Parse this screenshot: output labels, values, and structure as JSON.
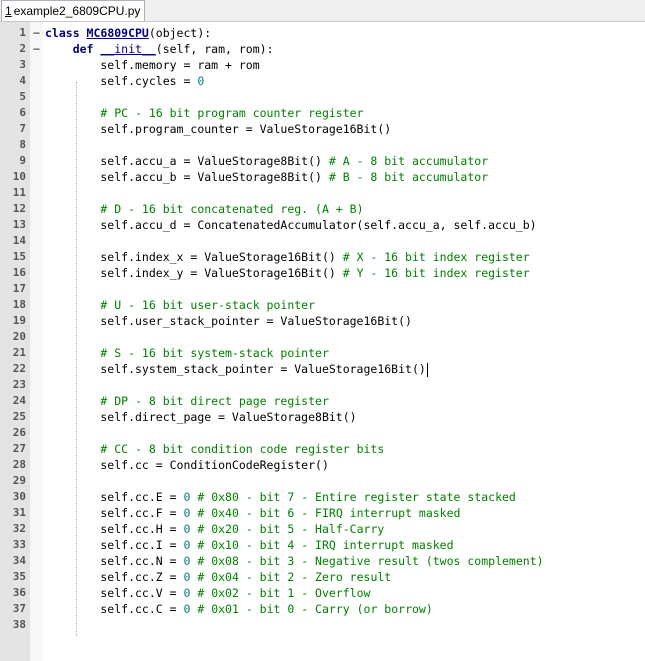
{
  "tab": {
    "number": "1",
    "filename": "example2_6809CPU.py"
  },
  "lines": [
    {
      "n": "1",
      "fold": "−",
      "segs": [
        [
          "kw",
          "class "
        ],
        [
          "cls",
          "MC6809CPU"
        ],
        [
          "p",
          "(object):"
        ]
      ]
    },
    {
      "n": "2",
      "fold": "−",
      "segs": [
        [
          "p",
          "    "
        ],
        [
          "kw",
          "def "
        ],
        [
          "fn",
          "__init__"
        ],
        [
          "p",
          "(self, ram, rom):"
        ]
      ]
    },
    {
      "n": "3",
      "fold": "",
      "segs": [
        [
          "p",
          "        self.memory = ram + rom"
        ]
      ]
    },
    {
      "n": "4",
      "fold": "",
      "segs": [
        [
          "p",
          "        self.cycles = "
        ],
        [
          "nm",
          "0"
        ]
      ]
    },
    {
      "n": "5",
      "fold": "",
      "segs": []
    },
    {
      "n": "6",
      "fold": "",
      "segs": [
        [
          "p",
          "        "
        ],
        [
          "cm",
          "# PC - 16 bit program counter register"
        ]
      ]
    },
    {
      "n": "7",
      "fold": "",
      "segs": [
        [
          "p",
          "        self.program_counter = ValueStorage16Bit()"
        ]
      ]
    },
    {
      "n": "8",
      "fold": "",
      "segs": []
    },
    {
      "n": "9",
      "fold": "",
      "segs": [
        [
          "p",
          "        self.accu_a = ValueStorage8Bit() "
        ],
        [
          "cm",
          "# A - 8 bit accumulator"
        ]
      ]
    },
    {
      "n": "10",
      "fold": "",
      "segs": [
        [
          "p",
          "        self.accu_b = ValueStorage8Bit() "
        ],
        [
          "cm",
          "# B - 8 bit accumulator"
        ]
      ]
    },
    {
      "n": "11",
      "fold": "",
      "segs": []
    },
    {
      "n": "12",
      "fold": "",
      "segs": [
        [
          "p",
          "        "
        ],
        [
          "cm",
          "# D - 16 bit concatenated reg. (A + B)"
        ]
      ]
    },
    {
      "n": "13",
      "fold": "",
      "segs": [
        [
          "p",
          "        self.accu_d = ConcatenatedAccumulator(self.accu_a, self.accu_b)"
        ]
      ]
    },
    {
      "n": "14",
      "fold": "",
      "segs": []
    },
    {
      "n": "15",
      "fold": "",
      "segs": [
        [
          "p",
          "        self.index_x = ValueStorage16Bit() "
        ],
        [
          "cm",
          "# X - 16 bit index register"
        ]
      ]
    },
    {
      "n": "16",
      "fold": "",
      "segs": [
        [
          "p",
          "        self.index_y = ValueStorage16Bit() "
        ],
        [
          "cm",
          "# Y - 16 bit index register"
        ]
      ]
    },
    {
      "n": "17",
      "fold": "",
      "segs": []
    },
    {
      "n": "18",
      "fold": "",
      "segs": [
        [
          "p",
          "        "
        ],
        [
          "cm",
          "# U - 16 bit user-stack pointer"
        ]
      ]
    },
    {
      "n": "19",
      "fold": "",
      "segs": [
        [
          "p",
          "        self.user_stack_pointer = ValueStorage16Bit()"
        ]
      ]
    },
    {
      "n": "20",
      "fold": "",
      "segs": []
    },
    {
      "n": "21",
      "fold": "",
      "segs": [
        [
          "p",
          "        "
        ],
        [
          "cm",
          "# S - 16 bit system-stack pointer"
        ]
      ]
    },
    {
      "n": "22",
      "fold": "",
      "caret": true,
      "segs": [
        [
          "p",
          "        self.system_stack_pointer = ValueStorage16Bit()"
        ]
      ]
    },
    {
      "n": "23",
      "fold": "",
      "segs": []
    },
    {
      "n": "24",
      "fold": "",
      "segs": [
        [
          "p",
          "        "
        ],
        [
          "cm",
          "# DP - 8 bit direct page register"
        ]
      ]
    },
    {
      "n": "25",
      "fold": "",
      "segs": [
        [
          "p",
          "        self.direct_page = ValueStorage8Bit()"
        ]
      ]
    },
    {
      "n": "26",
      "fold": "",
      "segs": []
    },
    {
      "n": "27",
      "fold": "",
      "segs": [
        [
          "p",
          "        "
        ],
        [
          "cm",
          "# CC - 8 bit condition code register bits"
        ]
      ]
    },
    {
      "n": "28",
      "fold": "",
      "segs": [
        [
          "p",
          "        self.cc = ConditionCodeRegister()"
        ]
      ]
    },
    {
      "n": "29",
      "fold": "",
      "segs": []
    },
    {
      "n": "30",
      "fold": "",
      "segs": [
        [
          "p",
          "        self.cc.E = "
        ],
        [
          "nm",
          "0"
        ],
        [
          "p",
          " "
        ],
        [
          "cm",
          "# 0x80 - bit 7 - Entire register state stacked"
        ]
      ]
    },
    {
      "n": "31",
      "fold": "",
      "segs": [
        [
          "p",
          "        self.cc.F = "
        ],
        [
          "nm",
          "0"
        ],
        [
          "p",
          " "
        ],
        [
          "cm",
          "# 0x40 - bit 6 - FIRQ interrupt masked"
        ]
      ]
    },
    {
      "n": "32",
      "fold": "",
      "segs": [
        [
          "p",
          "        self.cc.H = "
        ],
        [
          "nm",
          "0"
        ],
        [
          "p",
          " "
        ],
        [
          "cm",
          "# 0x20 - bit 5 - Half-Carry"
        ]
      ]
    },
    {
      "n": "33",
      "fold": "",
      "segs": [
        [
          "p",
          "        self.cc.I = "
        ],
        [
          "nm",
          "0"
        ],
        [
          "p",
          " "
        ],
        [
          "cm",
          "# 0x10 - bit 4 - IRQ interrupt masked"
        ]
      ]
    },
    {
      "n": "34",
      "fold": "",
      "segs": [
        [
          "p",
          "        self.cc.N = "
        ],
        [
          "nm",
          "0"
        ],
        [
          "p",
          " "
        ],
        [
          "cm",
          "# 0x08 - bit 3 - Negative result (twos complement)"
        ]
      ]
    },
    {
      "n": "35",
      "fold": "",
      "segs": [
        [
          "p",
          "        self.cc.Z = "
        ],
        [
          "nm",
          "0"
        ],
        [
          "p",
          " "
        ],
        [
          "cm",
          "# 0x04 - bit 2 - Zero result"
        ]
      ]
    },
    {
      "n": "36",
      "fold": "",
      "segs": [
        [
          "p",
          "        self.cc.V = "
        ],
        [
          "nm",
          "0"
        ],
        [
          "p",
          " "
        ],
        [
          "cm",
          "# 0x02 - bit 1 - Overflow"
        ]
      ]
    },
    {
      "n": "37",
      "fold": "",
      "segs": [
        [
          "p",
          "        self.cc.C = "
        ],
        [
          "nm",
          "0"
        ],
        [
          "p",
          " "
        ],
        [
          "cm",
          "# 0x01 - bit 0 - Carry (or borrow)"
        ]
      ]
    },
    {
      "n": "38",
      "fold": "",
      "segs": []
    }
  ]
}
